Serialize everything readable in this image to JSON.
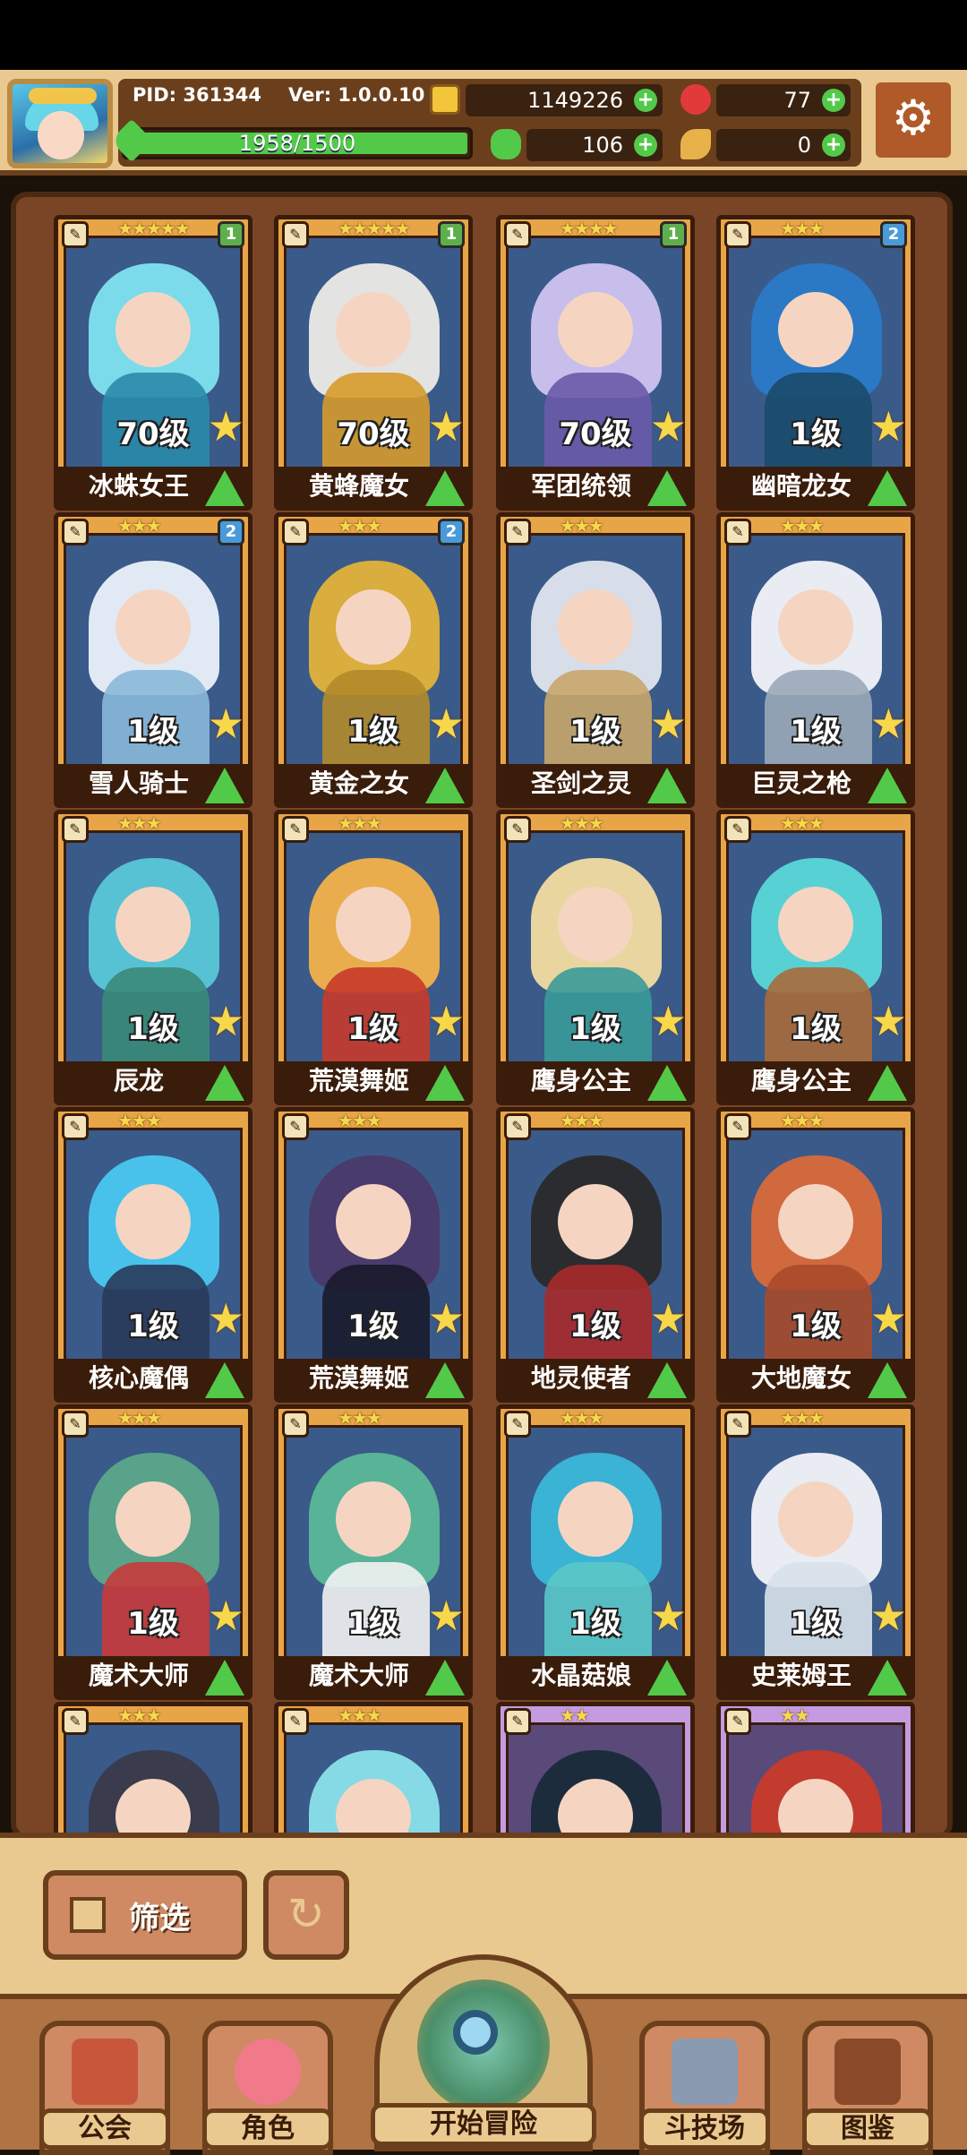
{
  "hud": {
    "pid": "PID: 361344",
    "version": "Ver: 1.0.0.10",
    "xp_text": "1958/1500",
    "xp_fill_fraction": 1.0,
    "gold": "1149226",
    "gems": "77",
    "clover": "106",
    "key_item": "0"
  },
  "cards": [
    {
      "name": "冰蛛女王",
      "level": "70级",
      "stars": "★★★★★",
      "badge": "1",
      "badge_color": "#5fae4e",
      "hair": "#7fe3ef",
      "body": "#2a8aa8",
      "frame": "orange"
    },
    {
      "name": "黄蜂魔女",
      "level": "70级",
      "stars": "★★★★★",
      "badge": "1",
      "badge_color": "#5fae4e",
      "hair": "#ecebe6",
      "body": "#d69a2a",
      "frame": "orange"
    },
    {
      "name": "军团统领",
      "level": "70级",
      "stars": "★★★★",
      "badge": "1",
      "badge_color": "#5fae4e",
      "hair": "#cfc4f0",
      "body": "#6a5aa8",
      "frame": "orange"
    },
    {
      "name": "幽暗龙女",
      "level": "1级",
      "stars": "★★★",
      "badge": "2",
      "badge_color": "#4a9ad8",
      "hair": "#2a7ac8",
      "body": "#1a4a6a",
      "frame": "orange"
    },
    {
      "name": "雪人骑士",
      "level": "1级",
      "stars": "★★★",
      "badge": "2",
      "badge_color": "#4a9ad8",
      "hair": "#eaf2fa",
      "body": "#8ab8d8",
      "frame": "orange"
    },
    {
      "name": "黄金之女",
      "level": "1级",
      "stars": "★★★",
      "badge": "2",
      "badge_color": "#4a9ad8",
      "hair": "#e2b23a",
      "body": "#b28a2a",
      "frame": "orange"
    },
    {
      "name": "圣剑之灵",
      "level": "1级",
      "stars": "★★★",
      "badge": "",
      "badge_color": "",
      "hair": "#dfe6ef",
      "body": "#c8a66a",
      "frame": "orange"
    },
    {
      "name": "巨灵之枪",
      "level": "1级",
      "stars": "★★★",
      "badge": "",
      "badge_color": "",
      "hair": "#f2f4f8",
      "body": "#9aa8b8",
      "frame": "orange"
    },
    {
      "name": "辰龙",
      "level": "1级",
      "stars": "★★★",
      "badge": "",
      "badge_color": "",
      "hair": "#58c8d8",
      "body": "#3a8a78",
      "frame": "orange"
    },
    {
      "name": "荒漠舞姬",
      "level": "1级",
      "stars": "★★★",
      "badge": "",
      "badge_color": "",
      "hair": "#f2b24a",
      "body": "#c83a2a",
      "frame": "orange"
    },
    {
      "name": "鹰身公主",
      "level": "1级",
      "stars": "★★★",
      "badge": "",
      "badge_color": "",
      "hair": "#f2dca0",
      "body": "#3a9a98",
      "frame": "orange"
    },
    {
      "name": "鹰身公主",
      "level": "1级",
      "stars": "★★★",
      "badge": "",
      "badge_color": "",
      "hair": "#5ad8d8",
      "body": "#a86a3a",
      "frame": "orange"
    },
    {
      "name": "核心魔偶",
      "level": "1级",
      "stars": "★★★",
      "badge": "",
      "badge_color": "",
      "hair": "#4ac8f0",
      "body": "#2a3a5a",
      "frame": "orange"
    },
    {
      "name": "荒漠舞姬",
      "level": "1级",
      "stars": "★★★",
      "badge": "",
      "badge_color": "",
      "hair": "#4a3a6a",
      "body": "#1a1a2a",
      "frame": "orange"
    },
    {
      "name": "地灵使者",
      "level": "1级",
      "stars": "★★★",
      "badge": "",
      "badge_color": "",
      "hair": "#2a2a2a",
      "body": "#a82a2a",
      "frame": "orange"
    },
    {
      "name": "大地魔女",
      "level": "1级",
      "stars": "★★★",
      "badge": "",
      "badge_color": "",
      "hair": "#d86a3a",
      "body": "#a84a2a",
      "frame": "orange"
    },
    {
      "name": "魔术大师",
      "level": "1级",
      "stars": "★★★",
      "badge": "",
      "badge_color": "",
      "hair": "#5aa88a",
      "body": "#c83a3a",
      "frame": "orange"
    },
    {
      "name": "魔术大师",
      "level": "1级",
      "stars": "★★★",
      "badge": "",
      "badge_color": "",
      "hair": "#5ab898",
      "body": "#f2f2f2",
      "frame": "orange"
    },
    {
      "name": "水晶菇娘",
      "level": "1级",
      "stars": "★★★",
      "badge": "",
      "badge_color": "",
      "hair": "#3ab8d8",
      "body": "#5ac8c8",
      "frame": "orange"
    },
    {
      "name": "史莱姆王",
      "level": "1级",
      "stars": "★★★",
      "badge": "",
      "badge_color": "",
      "hair": "#f2f4f8",
      "body": "#d8e2ea",
      "frame": "orange"
    },
    {
      "name": "",
      "level": "",
      "stars": "★★★",
      "badge": "",
      "badge_color": "",
      "hair": "#3a3a4a",
      "body": "#2a2a3a",
      "frame": "orange"
    },
    {
      "name": "",
      "level": "",
      "stars": "★★★",
      "badge": "",
      "badge_color": "",
      "hair": "#8ae2ea",
      "body": "#5ac8d8",
      "frame": "orange"
    },
    {
      "name": "",
      "level": "",
      "stars": "★★",
      "badge": "",
      "badge_color": "",
      "hair": "#1a2a3a",
      "body": "#3a8a3a",
      "frame": "purple"
    },
    {
      "name": "",
      "level": "",
      "stars": "★★",
      "badge": "",
      "badge_color": "",
      "hair": "#c83a2a",
      "body": "#8a2a2a",
      "frame": "purple"
    }
  ],
  "toolbar": {
    "filter_label": "筛选"
  },
  "nav": {
    "guild": "公会",
    "character": "角色",
    "adventure": "开始冒险",
    "arena": "斗技场",
    "codex": "图鉴"
  }
}
